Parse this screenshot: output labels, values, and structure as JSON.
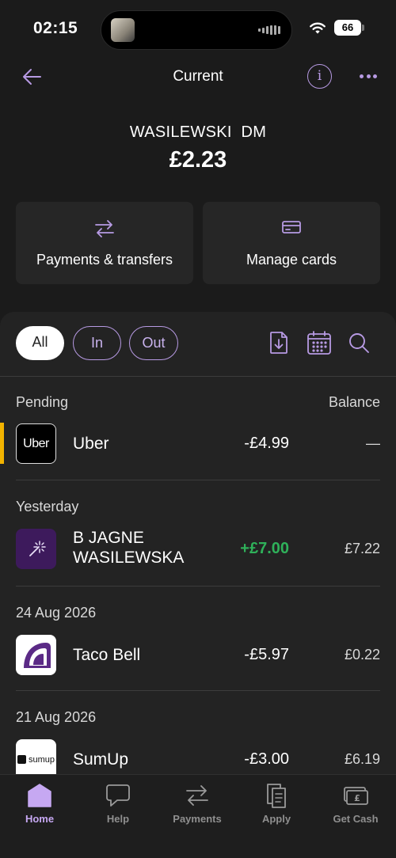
{
  "status_bar": {
    "time": "02:15",
    "battery": "66"
  },
  "header": {
    "title": "Current"
  },
  "account": {
    "name": "WASILEWSKI  DM",
    "balance": "£2.23"
  },
  "actions": [
    {
      "label": "Payments & transfers",
      "icon": "transfer-arrows-icon"
    },
    {
      "label": "Manage cards",
      "icon": "card-icon"
    }
  ],
  "filters": [
    {
      "label": "All",
      "active": true
    },
    {
      "label": "In",
      "active": false
    },
    {
      "label": "Out",
      "active": false
    }
  ],
  "tools": [
    "statement-download-icon",
    "calendar-icon",
    "search-icon"
  ],
  "transactions": {
    "balance_header": "Balance",
    "groups": [
      {
        "label": "Pending",
        "items": [
          {
            "merchant": "Uber",
            "amount": "-£4.99",
            "balance": "—",
            "logo": "uber-logo"
          }
        ]
      },
      {
        "label": "Yesterday",
        "items": [
          {
            "merchant_line1": "B JAGNE",
            "merchant_line2": "WASILEWSKA",
            "amount": "+£7.00",
            "balance": "£7.22",
            "logo": "sparkle-icon"
          }
        ]
      },
      {
        "label": "24 Aug 2026",
        "items": [
          {
            "merchant": "Taco Bell",
            "amount": "-£5.97",
            "balance": "£0.22",
            "logo": "taco-bell-logo"
          }
        ]
      },
      {
        "label": "21 Aug 2026",
        "items": [
          {
            "merchant": "SumUp",
            "amount": "-£3.00",
            "balance": "£6.19",
            "logo": "sumup-logo",
            "logo_text": "sumup"
          }
        ]
      }
    ]
  },
  "tab_bar": [
    {
      "label": "Home",
      "icon": "home-icon",
      "active": true
    },
    {
      "label": "Help",
      "icon": "chat-bubble-icon",
      "active": false
    },
    {
      "label": "Payments",
      "icon": "transfer-arrows-icon",
      "active": false
    },
    {
      "label": "Apply",
      "icon": "documents-icon",
      "active": false
    },
    {
      "label": "Get Cash",
      "icon": "cash-icon",
      "active": false
    }
  ],
  "colors": {
    "accent": "#b79ae3",
    "credit": "#2fb15a",
    "pending": "#f2b300",
    "background": "#1b1b1b",
    "panel": "#232323"
  }
}
